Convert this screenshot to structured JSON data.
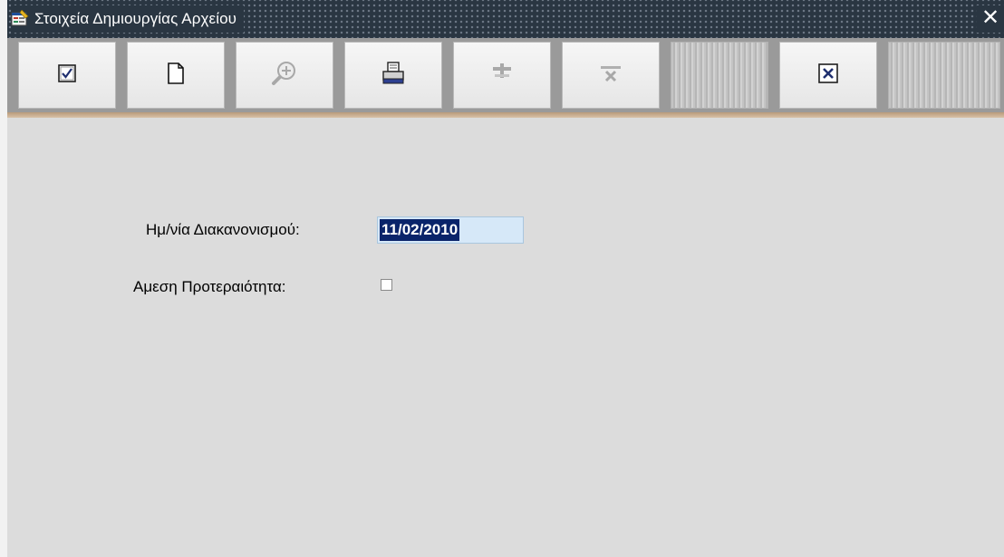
{
  "window": {
    "title": "Στοιχεία Δημιουργίας Αρχείου",
    "close_glyph": "✕"
  },
  "toolbar": {
    "buttons": [
      {
        "name": "save-check-icon",
        "enabled": true
      },
      {
        "name": "new-document-icon",
        "enabled": true
      },
      {
        "name": "zoom-search-icon",
        "enabled": false
      },
      {
        "name": "print-icon",
        "enabled": true
      },
      {
        "name": "insert-record-icon",
        "enabled": false
      },
      {
        "name": "delete-record-icon",
        "enabled": false
      },
      {
        "name": "exit-icon",
        "enabled": true
      }
    ]
  },
  "form": {
    "settlement_date_label": "Ημ/νία Διακανονισμού:",
    "settlement_date_value": "11/02/2010",
    "priority_label": "Αμεση Προτεραιότητα:",
    "priority_checked": false
  },
  "colors": {
    "titlebar": "#2a3642",
    "selection": "#0a246a",
    "field_bg": "#d6e8f8",
    "accent": "#c8ad90"
  }
}
